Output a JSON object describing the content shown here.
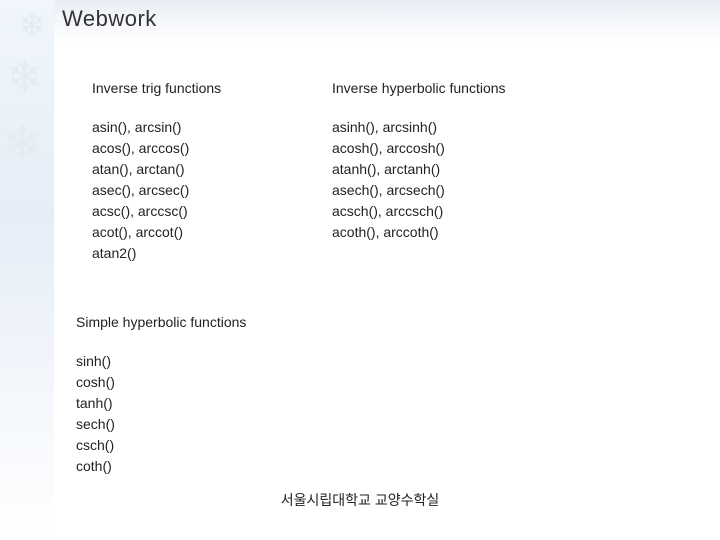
{
  "title": "Webwork",
  "colA": {
    "heading": "Inverse trig functions",
    "items": [
      "asin(), arcsin()",
      "acos(), arccos()",
      "atan(), arctan()",
      "asec(), arcsec()",
      "acsc(), arccsc()",
      "acot(), arccot()",
      "atan2()"
    ]
  },
  "colB": {
    "heading": "Inverse hyperbolic functions",
    "items": [
      "asinh(), arcsinh()",
      "acosh(), arccosh()",
      "atanh(), arctanh()",
      "asech(), arcsech()",
      "acsch(), arccsch()",
      "acoth(), arccoth()"
    ]
  },
  "colC": {
    "heading": "Simple hyperbolic functions",
    "items": [
      "sinh()",
      "cosh()",
      "tanh()",
      "sech()",
      "csch()",
      "coth()"
    ]
  },
  "footer": "서울시립대학교 교양수학실"
}
